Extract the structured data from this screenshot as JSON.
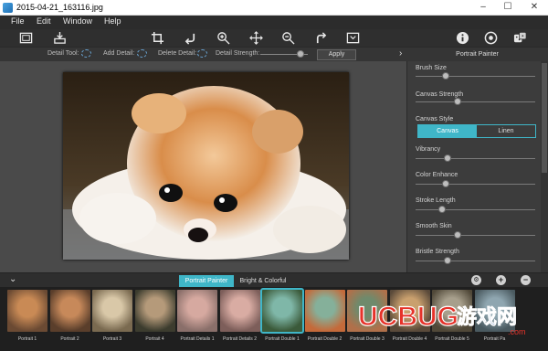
{
  "window": {
    "title": "2015-04-21_163116.jpg"
  },
  "menu": [
    "File",
    "Edit",
    "Window",
    "Help"
  ],
  "toolbar": {
    "icons": [
      "frame-icon",
      "save-icon",
      "crop-icon",
      "rotate-left-icon",
      "zoom-in-icon",
      "move-icon",
      "zoom-out-icon",
      "rotate-right-icon",
      "fit-screen-icon",
      "info-icon",
      "settings-icon",
      "random-icon"
    ]
  },
  "options": {
    "detail_tool": "Detail Tool:",
    "add_detail": "Add Detail:",
    "delete_detail": "Delete Detail:",
    "detail_strength": "Detail Strength:",
    "detail_strength_level": 0.85,
    "apply": "Apply"
  },
  "panel": {
    "title": "Portrait Painter",
    "sliders": [
      {
        "label": "Brush Size",
        "level": 0.25
      },
      {
        "label": "Canvas Strength",
        "level": 0.35
      },
      {
        "label": "Vibrancy",
        "level": 0.27
      },
      {
        "label": "Color Enhance",
        "level": 0.25
      },
      {
        "label": "Stroke Length",
        "level": 0.22
      },
      {
        "label": "Smooth Skin",
        "level": 0.35
      },
      {
        "label": "Bristle Strength",
        "level": 0.27
      }
    ],
    "canvas_style_label": "Canvas Style",
    "canvas_options": [
      "Canvas",
      "Linen"
    ],
    "canvas_selected": "Canvas"
  },
  "filters": {
    "tabs": [
      "Portrait Painter",
      "Bright & Colorful"
    ],
    "active_tab": "Portrait Painter"
  },
  "thumbnails": [
    {
      "label": "Portrait 1",
      "colors": [
        "#c98a55",
        "#6b4a33"
      ]
    },
    {
      "label": "Portrait 2",
      "colors": [
        "#c7895a",
        "#5a3e2b"
      ]
    },
    {
      "label": "Portrait 3",
      "colors": [
        "#d9c8a8",
        "#7a6a50"
      ]
    },
    {
      "label": "Portrait 4",
      "colors": [
        "#b59a7a",
        "#3c3c2e"
      ]
    },
    {
      "label": "Portrait Details 1",
      "colors": [
        "#d6a9a0",
        "#8a6f6a"
      ]
    },
    {
      "label": "Portrait Details 2",
      "colors": [
        "#d9aca3",
        "#7d5e5a"
      ]
    },
    {
      "label": "Portrait Double 1",
      "colors": [
        "#7fb7a8",
        "#3b5a3a"
      ]
    },
    {
      "label": "Portrait Double 2",
      "colors": [
        "#85b09a",
        "#c46a3a"
      ]
    },
    {
      "label": "Portrait Double 3",
      "colors": [
        "#6f8a6c",
        "#b0704a"
      ]
    },
    {
      "label": "Portrait Double 4",
      "colors": [
        "#c9a06e",
        "#5a4a3a"
      ]
    },
    {
      "label": "Portrait Double 5",
      "colors": [
        "#a79f8c",
        "#504838"
      ]
    },
    {
      "label": "Portrait Pa",
      "colors": [
        "#8fa6b0",
        "#4a5a60"
      ]
    }
  ],
  "watermark": {
    "text": "UCBUG游戏网",
    "subtext": ".com"
  },
  "colors": {
    "accent": "#3fb6c8"
  }
}
